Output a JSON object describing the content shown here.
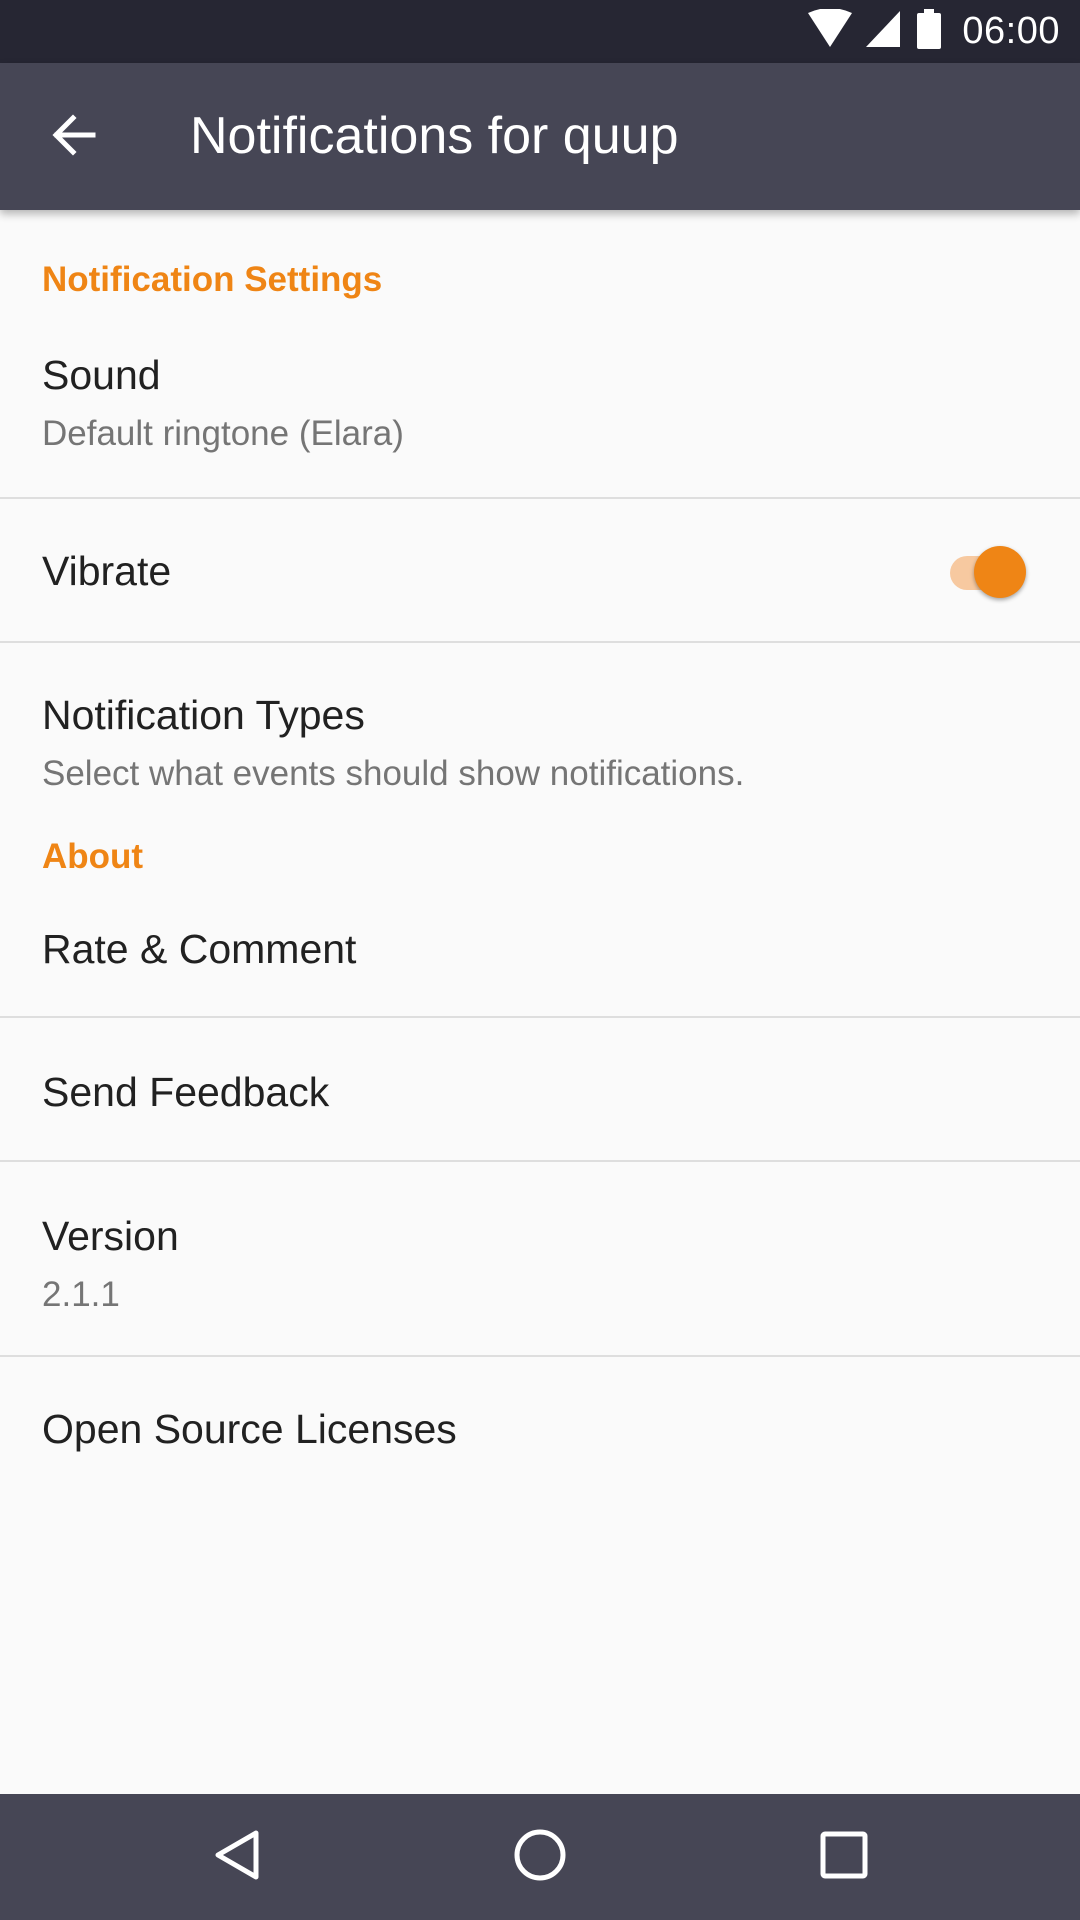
{
  "status_bar": {
    "time": "06:00",
    "icons": [
      "wifi-icon",
      "cell-signal-icon",
      "battery-icon"
    ]
  },
  "app_bar": {
    "title": "Notifications for quup",
    "back_icon": "arrow-back-icon"
  },
  "sections": {
    "notification_settings": {
      "header": "Notification Settings",
      "sound": {
        "title": "Sound",
        "summary": "Default ringtone (Elara)"
      },
      "vibrate": {
        "title": "Vibrate",
        "enabled": true
      },
      "notification_types": {
        "title": "Notification Types",
        "summary": "Select what events should show notifications."
      }
    },
    "about": {
      "header": "About",
      "rate": {
        "title": "Rate & Comment"
      },
      "feedback": {
        "title": "Send Feedback"
      },
      "version": {
        "title": "Version",
        "summary": "2.1.1"
      },
      "licenses": {
        "title": "Open Source Licenses"
      }
    }
  },
  "nav_bar": {
    "icons": [
      "nav-back-icon",
      "nav-home-icon",
      "nav-recents-icon"
    ]
  },
  "colors": {
    "accent": "#ef8515",
    "app_bar": "#464655",
    "status_bar": "#262633",
    "background": "#fafafa"
  }
}
